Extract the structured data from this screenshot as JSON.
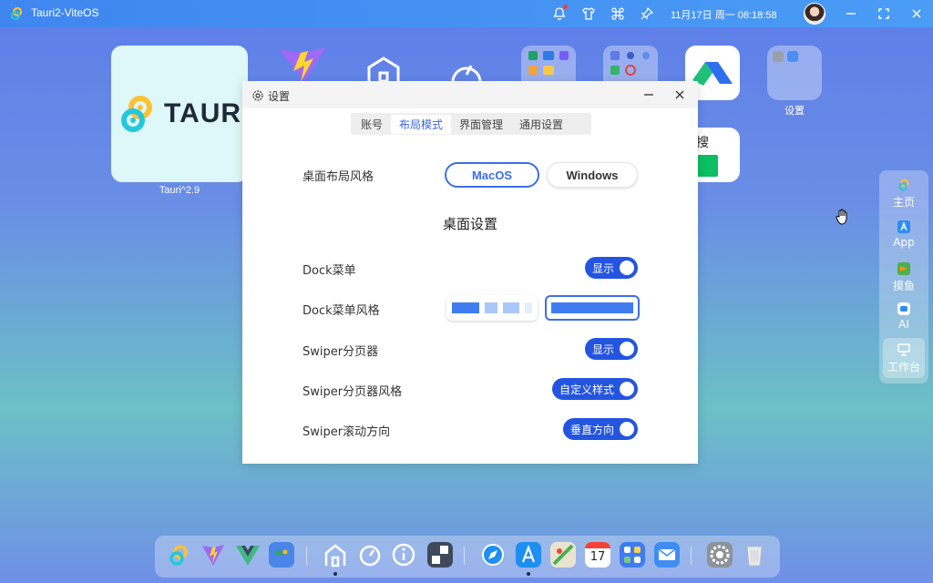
{
  "topbar": {
    "app_title": "Tauri2-ViteOS",
    "clock": "11月17日 周一 08:18:58",
    "icons": [
      "bell-icon",
      "shirt-icon",
      "command-icon",
      "pin-icon",
      "avatar",
      "minimize-icon",
      "fullscreen-icon",
      "close-icon"
    ]
  },
  "desktop": {
    "tiles": [
      {
        "name": "tauri-app",
        "label": "Tauri^2.9",
        "logo_text": "TAURI"
      },
      {
        "name": "settings-app",
        "label": "设置"
      },
      {
        "name": "search-app",
        "partial_text": "搜"
      }
    ]
  },
  "window": {
    "title": "设置",
    "tabs": [
      "账号",
      "布局模式",
      "界面管理",
      "通用设置"
    ],
    "active_tab": "布局模式",
    "layout_style_label": "桌面布局风格",
    "layout_options": [
      "MacOS",
      "Windows"
    ],
    "layout_selected": "MacOS",
    "section_title": "桌面设置",
    "rows": [
      {
        "label": "Dock菜单",
        "toggle_text": "显示"
      },
      {
        "label": "Dock菜单风格",
        "options": [
          "segmented",
          "full"
        ],
        "selected": "full"
      },
      {
        "label": "Swiper分页器",
        "toggle_text": "显示"
      },
      {
        "label": "Swiper分页器风格",
        "toggle_text": "自定义样式"
      },
      {
        "label": "Swiper滚动方向",
        "toggle_text": "垂直方向"
      }
    ]
  },
  "sidedock": {
    "items": [
      {
        "label": "主页",
        "icon": "tauri-icon"
      },
      {
        "label": "App",
        "icon": "appstore-icon"
      },
      {
        "label": "摸鱼",
        "icon": "fish-icon"
      },
      {
        "label": "AI",
        "icon": "robot-icon"
      },
      {
        "label": "工作台",
        "icon": "monitor-icon",
        "active": true
      }
    ]
  },
  "dock": {
    "calendar_day": "17",
    "icons": [
      "tauri-icon",
      "vite-icon",
      "vue-icon",
      "maps-icon",
      "home-icon",
      "dashboard-icon",
      "info-icon",
      "hm-icon",
      "safari-icon",
      "appstore-icon",
      "maps2-icon",
      "calendar-icon",
      "apps-grid-icon",
      "mail-icon",
      "settings-icon",
      "trash-icon"
    ]
  },
  "colors": {
    "accent": "#2455e0",
    "topbar": "#4a9cf5",
    "selected_border": "#3a6fe8"
  }
}
